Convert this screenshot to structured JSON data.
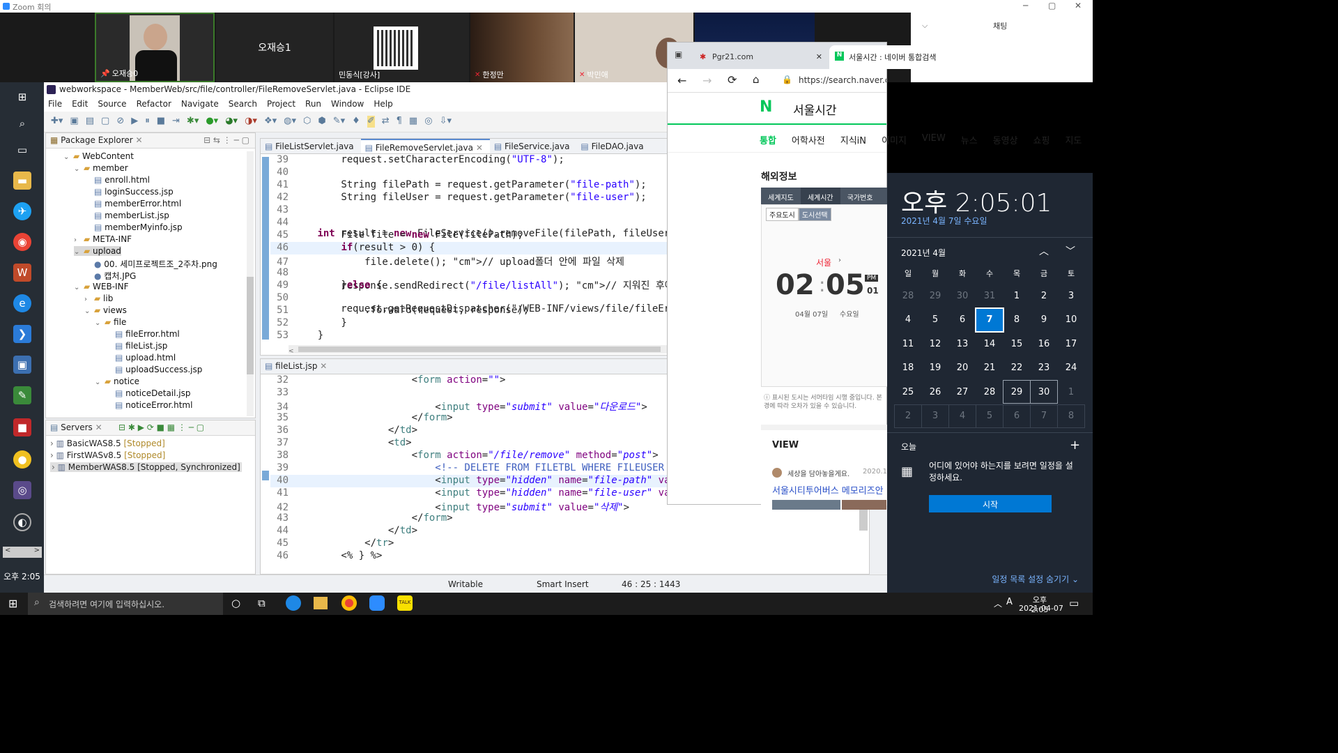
{
  "zoom": {
    "title": "Zoom 회의",
    "chat_title": "채팅",
    "participants": [
      {
        "name": "오재승0",
        "kind": "video"
      },
      {
        "name": "오재승1",
        "kind": "name"
      },
      {
        "name": "민동식[강사]",
        "kind": "qr"
      },
      {
        "name": "한정만",
        "kind": "video"
      },
      {
        "name": "박민애",
        "kind": "video"
      }
    ]
  },
  "eclipse": {
    "title": "webworkspace - MemberWeb/src/file/controller/FileRemoveServlet.java - Eclipse IDE",
    "menu": [
      "File",
      "Edit",
      "Source",
      "Refactor",
      "Navigate",
      "Search",
      "Project",
      "Run",
      "Window",
      "Help"
    ],
    "package_explorer_title": "Package Explorer",
    "tree": [
      {
        "label": "WebContent",
        "type": "folder",
        "level": 1,
        "open": true
      },
      {
        "label": "member",
        "type": "folder",
        "level": 2,
        "open": true
      },
      {
        "label": "enroll.html",
        "type": "file",
        "level": 3
      },
      {
        "label": "loginSuccess.jsp",
        "type": "file",
        "level": 3
      },
      {
        "label": "memberError.html",
        "type": "file",
        "level": 3
      },
      {
        "label": "memberList.jsp",
        "type": "file",
        "level": 3
      },
      {
        "label": "memberMyinfo.jsp",
        "type": "file",
        "level": 3
      },
      {
        "label": "META-INF",
        "type": "folder",
        "level": 2,
        "open": false
      },
      {
        "label": "upload",
        "type": "folder",
        "level": 2,
        "open": true,
        "selected": true
      },
      {
        "label": "00. 세미프로젝트조_2주차.png",
        "type": "img",
        "level": 3
      },
      {
        "label": "캡처.JPG",
        "type": "img",
        "level": 3
      },
      {
        "label": "WEB-INF",
        "type": "folder",
        "level": 2,
        "open": true
      },
      {
        "label": "lib",
        "type": "folder",
        "level": 3,
        "open": false
      },
      {
        "label": "views",
        "type": "folder",
        "level": 3,
        "open": true
      },
      {
        "label": "file",
        "type": "folder",
        "level": 4,
        "open": true
      },
      {
        "label": "fileError.html",
        "type": "file",
        "level": 5
      },
      {
        "label": "fileList.jsp",
        "type": "file",
        "level": 5
      },
      {
        "label": "upload.html",
        "type": "file",
        "level": 5
      },
      {
        "label": "uploadSuccess.jsp",
        "type": "file",
        "level": 5
      },
      {
        "label": "notice",
        "type": "folder",
        "level": 4,
        "open": true
      },
      {
        "label": "noticeDetail.jsp",
        "type": "file",
        "level": 5
      },
      {
        "label": "noticeError.html",
        "type": "file",
        "level": 5
      }
    ],
    "servers_title": "Servers",
    "servers": [
      {
        "name": "BasicWAS8.5",
        "status": "[Stopped]"
      },
      {
        "name": "FirstWASv8.5",
        "status": "[Stopped]"
      },
      {
        "name": "MemberWAS8.5",
        "status": "[Stopped, Synchronized]"
      }
    ],
    "editor_tabs": [
      "FileListServlet.java",
      "FileRemoveServlet.java",
      "FileService.java",
      "FileDAO.java"
    ],
    "active_tab": 1,
    "code_top": [
      {
        "n": "39",
        "t": "        request.setCharacterEncoding(\"UTF-8\");"
      },
      {
        "n": "40",
        "t": ""
      },
      {
        "n": "41",
        "t": "        String filePath = request.getParameter(\"file-path\");"
      },
      {
        "n": "42",
        "t": "        String fileUser = request.getParameter(\"file-user\");"
      },
      {
        "n": "43",
        "t": ""
      },
      {
        "n": "44",
        "t": "        int result = new FileService().removeFile(filePath, fileUser);"
      },
      {
        "n": "45",
        "t": "        File file = new File(filePath);"
      },
      {
        "n": "46",
        "t": "        if(result > 0) {"
      },
      {
        "n": "47",
        "t": "            file.delete(); // upload폴더 안에 파일 삭제"
      },
      {
        "n": "48",
        "t": "            response.sendRedirect(\"/file/listAll\"); // 지워진 후에 리스"
      },
      {
        "n": "49",
        "t": "        }else {"
      },
      {
        "n": "50",
        "t": "            request.getRequestDispatcher(\"/WEB-INF/views/file/fileError"
      },
      {
        "n": "51",
        "t": "            .forward(request, response);"
      },
      {
        "n": "52",
        "t": "        }"
      },
      {
        "n": "53",
        "t": "    }"
      }
    ],
    "bottom_tab": "fileList.jsp",
    "code_bottom": [
      {
        "n": "32",
        "t": "                    <form action=\"\">"
      },
      {
        "n": "33",
        "t": ""
      },
      {
        "n": "34",
        "t": "                        <input type=\"submit\" value=\"다운로드\">"
      },
      {
        "n": "35",
        "t": "                    </form>"
      },
      {
        "n": "36",
        "t": "                </td>"
      },
      {
        "n": "37",
        "t": "                <td>"
      },
      {
        "n": "38",
        "t": "                    <form action=\"/file/remove\" method=\"post\">"
      },
      {
        "n": "39",
        "t": "                        <!-- DELETE FROM FILETBL WHERE FILEUSER = ? AND"
      },
      {
        "n": "40",
        "t": "                        <input type=\"hidden\" name=\"file-path\" value=\"<%"
      },
      {
        "n": "41",
        "t": "                        <input type=\"hidden\" name=\"file-user\" value=\"<%"
      },
      {
        "n": "42",
        "t": "                        <input type=\"submit\" value=\"삭제\">"
      },
      {
        "n": "43",
        "t": "                    </form>"
      },
      {
        "n": "44",
        "t": "                </td>"
      },
      {
        "n": "45",
        "t": "            </tr>"
      },
      {
        "n": "46",
        "t": "        <% } %>"
      }
    ],
    "status": {
      "mode": "Writable",
      "insert": "Smart Insert",
      "pos": "46 : 25 : 1443"
    }
  },
  "browser": {
    "tabs": [
      {
        "title": "Pgr21.com"
      },
      {
        "title": "서울시간 : 네이버 통합검색"
      }
    ],
    "url": "https://search.naver.com/search.naver?where=nexearch&sm=top_hty&fb",
    "query": "서울시간",
    "nav": [
      "통합",
      "어학사전",
      "지식iN",
      "이미지",
      "VIEW",
      "뉴스",
      "동영상",
      "쇼핑",
      "지도"
    ],
    "section_title": "해외정보",
    "subtabs": [
      "세계지도",
      "세계시간",
      "국가번호"
    ],
    "mini_tabs": [
      "주요도시",
      "도시선택"
    ],
    "city": "서울",
    "hour": "02",
    "minute": "05",
    "ampm": "PM",
    "sec": "01",
    "date_line": "04월 07일",
    "weekday": "수요일",
    "note": "표시된 도시는 서머타임 시행 중입니다. 본 경에 따라 오차가 있을 수 있습니다.",
    "view_title": "VIEW",
    "view_author": "세상을 담아놓을게요.",
    "view_date": "2020.11",
    "view_link": "서울시티투어버스 메모리즈안"
  },
  "calendar": {
    "time": "오후 2:05:01",
    "date": "2021년 4월 7일 수요일",
    "month": "2021년 4월",
    "weekdays": [
      "일",
      "월",
      "화",
      "수",
      "목",
      "금",
      "토"
    ],
    "weeks": [
      [
        "28",
        "29",
        "30",
        "31",
        "1",
        "2",
        "3"
      ],
      [
        "4",
        "5",
        "6",
        "7",
        "8",
        "9",
        "10"
      ],
      [
        "11",
        "12",
        "13",
        "14",
        "15",
        "16",
        "17"
      ],
      [
        "18",
        "19",
        "20",
        "21",
        "22",
        "23",
        "24"
      ],
      [
        "25",
        "26",
        "27",
        "28",
        "29",
        "30",
        "1"
      ],
      [
        "2",
        "3",
        "4",
        "5",
        "6",
        "7",
        "8"
      ]
    ],
    "today_label": "오늘",
    "no_event": "어디에 있어야 하는지를 보려면 일정을 설정하세요.",
    "start_button": "시작",
    "hide_label": "일정 목록 설정 숨기기"
  },
  "left_clock": "오후 2:05",
  "taskbar": {
    "search_placeholder": "검색하려면 여기에 입력하십시오.",
    "time": "오후 2:05",
    "date": "2021-04-07",
    "lang": "A"
  },
  "colors": {
    "naver_green": "#03c75a",
    "win_blue": "#0078d4",
    "calendar_bg": "#1f2733"
  }
}
